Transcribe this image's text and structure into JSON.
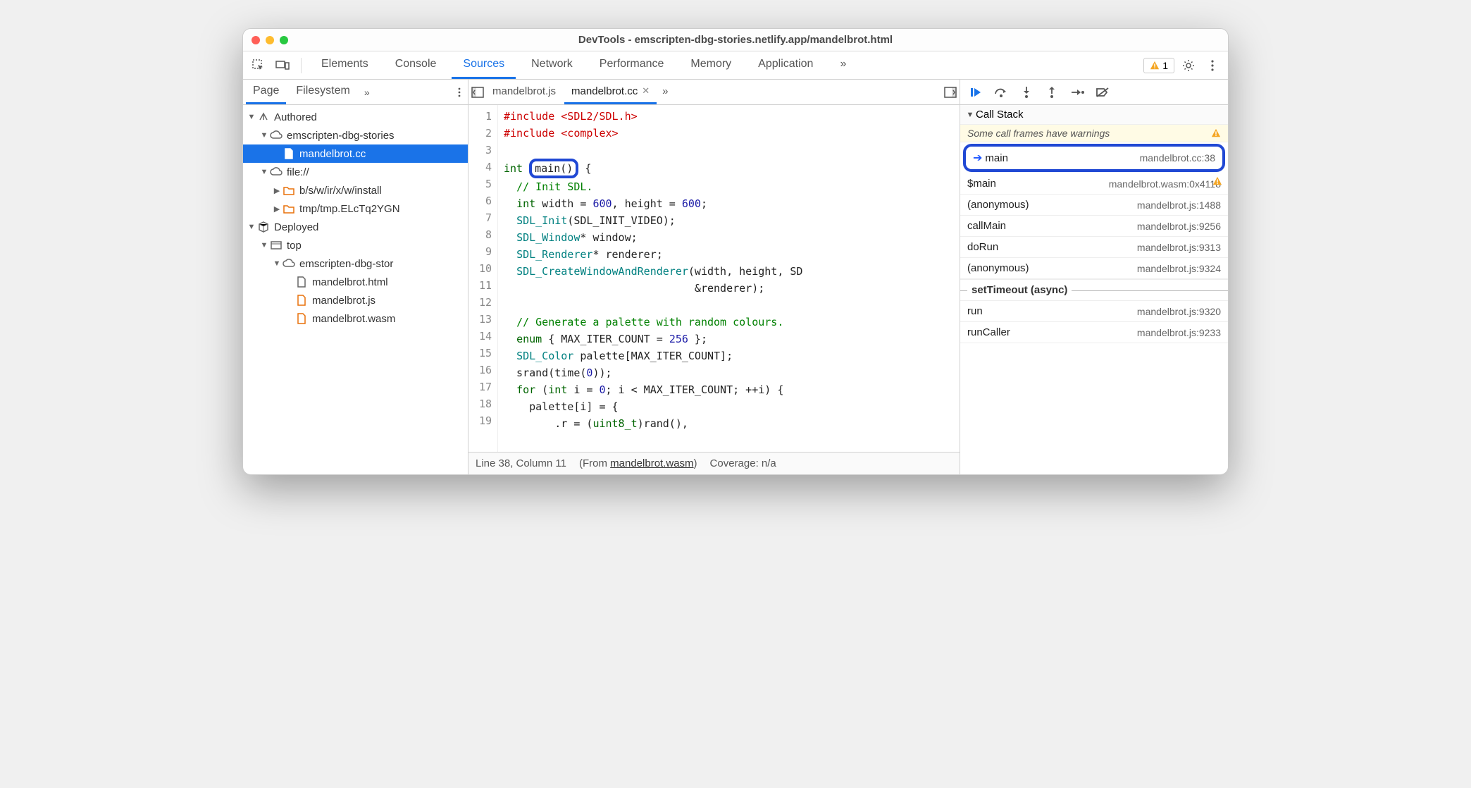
{
  "window_title": "DevTools - emscripten-dbg-stories.netlify.app/mandelbrot.html",
  "traffic_colors": {
    "close": "#ff5f57",
    "min": "#febc2e",
    "max": "#28c840"
  },
  "tabs": {
    "items": [
      "Elements",
      "Console",
      "Sources",
      "Network",
      "Performance",
      "Memory",
      "Application"
    ],
    "active": "Sources",
    "overflow": "»",
    "warn_count": "1"
  },
  "left": {
    "tabs": {
      "items": [
        "Page",
        "Filesystem"
      ],
      "overflow": "»",
      "active": "Page"
    },
    "tree": [
      {
        "depth": 0,
        "tw": "▼",
        "icon": "angle",
        "label": "Authored"
      },
      {
        "depth": 1,
        "tw": "▼",
        "icon": "cloud",
        "label": "emscripten-dbg-stories"
      },
      {
        "depth": 2,
        "tw": "",
        "icon": "file",
        "label": "mandelbrot.cc",
        "selected": true
      },
      {
        "depth": 1,
        "tw": "▼",
        "icon": "cloud",
        "label": "file://"
      },
      {
        "depth": 2,
        "tw": "▶",
        "icon": "folder",
        "label": "b/s/w/ir/x/w/install"
      },
      {
        "depth": 2,
        "tw": "▶",
        "icon": "folder",
        "label": "tmp/tmp.ELcTq2YGN"
      },
      {
        "depth": 0,
        "tw": "▼",
        "icon": "cube",
        "label": "Deployed"
      },
      {
        "depth": 1,
        "tw": "▼",
        "icon": "frame",
        "label": "top"
      },
      {
        "depth": 2,
        "tw": "▼",
        "icon": "cloud",
        "label": "emscripten-dbg-stor"
      },
      {
        "depth": 3,
        "tw": "",
        "icon": "file",
        "label": "mandelbrot.html"
      },
      {
        "depth": 3,
        "tw": "",
        "icon": "file-o",
        "label": "mandelbrot.js"
      },
      {
        "depth": 3,
        "tw": "",
        "icon": "file-o",
        "label": "mandelbrot.wasm"
      }
    ]
  },
  "center": {
    "tabs": [
      {
        "label": "mandelbrot.js",
        "active": false,
        "close": false
      },
      {
        "label": "mandelbrot.cc",
        "active": true,
        "close": true
      }
    ],
    "overflow": "»",
    "status": {
      "pos": "Line 38, Column 11",
      "from_label": "(From ",
      "from_file": "mandelbrot.wasm",
      "from_close": ")",
      "coverage": "Coverage: n/a"
    },
    "code_lines": 19
  },
  "right": {
    "callstack_label": "Call Stack",
    "warn_text": "Some call frames have warnings",
    "async_label": "setTimeout (async)",
    "frames": [
      {
        "name": "main",
        "loc": "mandelbrot.cc:38",
        "current": true
      },
      {
        "name": "$main",
        "loc": "mandelbrot.wasm:0x4118",
        "warn": true
      },
      {
        "name": "(anonymous)",
        "loc": "mandelbrot.js:1488"
      },
      {
        "name": "callMain",
        "loc": "mandelbrot.js:9256"
      },
      {
        "name": "doRun",
        "loc": "mandelbrot.js:9313"
      },
      {
        "name": "(anonymous)",
        "loc": "mandelbrot.js:9324"
      }
    ],
    "frames_after_async": [
      {
        "name": "run",
        "loc": "mandelbrot.js:9320"
      },
      {
        "name": "runCaller",
        "loc": "mandelbrot.js:9233"
      }
    ]
  }
}
